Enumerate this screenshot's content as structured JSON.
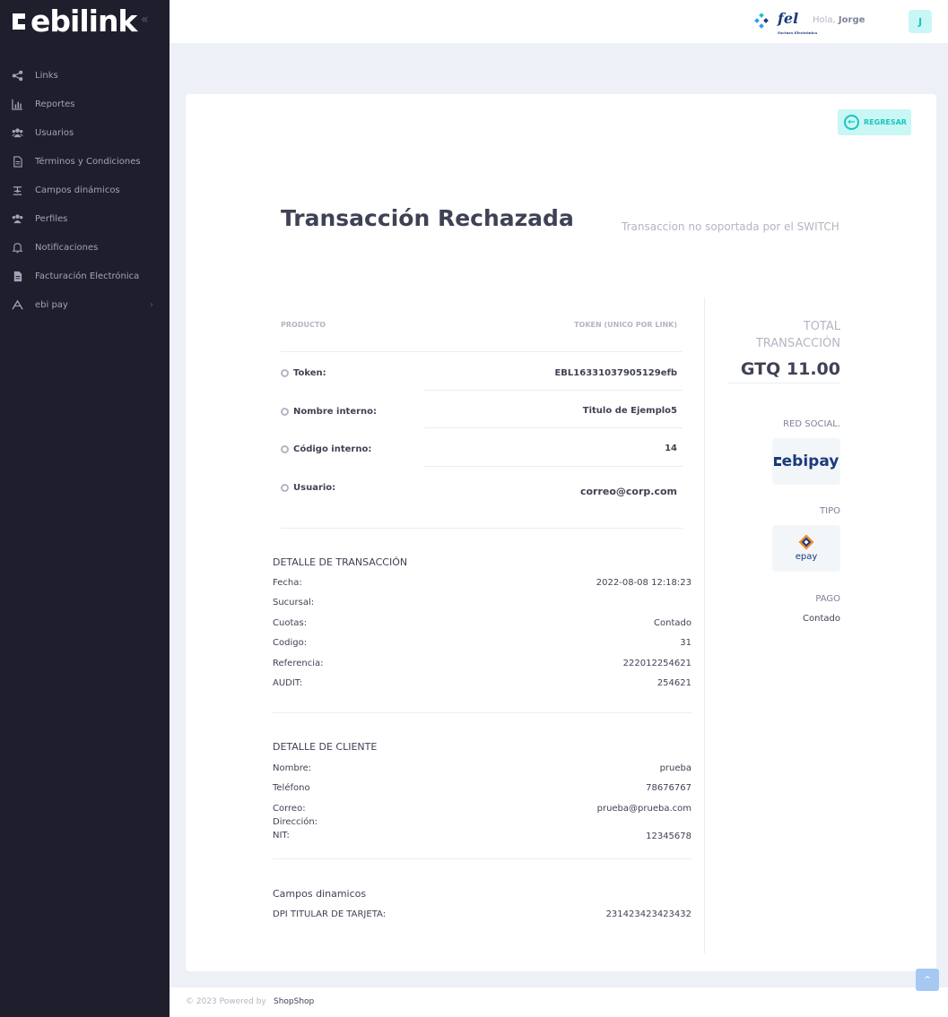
{
  "brand": {
    "logo_text": "ebilink"
  },
  "sidebar": {
    "items": [
      {
        "label": "Links",
        "icon": "share-icon"
      },
      {
        "label": "Reportes",
        "icon": "chart-icon"
      },
      {
        "label": "Usuarios",
        "icon": "users-icon"
      },
      {
        "label": "Términos y Condiciones",
        "icon": "document-icon"
      },
      {
        "label": "Campos dinámicos",
        "icon": "fields-icon"
      },
      {
        "label": "Perfiles",
        "icon": "profiles-icon"
      },
      {
        "label": "Notificaciones",
        "icon": "bell-icon"
      },
      {
        "label": "Facturación Electrónica",
        "icon": "invoice-icon"
      },
      {
        "label": "ebi pay",
        "icon": "ebipay-icon",
        "has_children": true
      }
    ]
  },
  "header": {
    "partner_logo_text": "fel",
    "partner_logo_sub": "Factura Electrónica",
    "greeting": "Hola,",
    "user_name": "Jorge",
    "avatar_initial": "J"
  },
  "card": {
    "back_button": "REGRESAR",
    "title": "Transacción Rechazada",
    "subtitle": "Transaccion no soportada por el SWITCH",
    "product_table": {
      "col_left": "PRODUCTO",
      "col_right": "TOKEN (UNICO POR LINK)",
      "rows": [
        {
          "label": "Token:",
          "value": "EBL16331037905129efb"
        },
        {
          "label": "Nombre interno:",
          "value": "Titulo de Ejemplo5"
        },
        {
          "label": "Código interno:",
          "value": "14"
        },
        {
          "label": "Usuario:",
          "value": "correo@corp.com"
        }
      ]
    },
    "transaction": {
      "title": "DETALLE DE TRANSACCIÓN",
      "rows": [
        {
          "label": "Fecha:",
          "value": "2022-08-08 12:18:23"
        },
        {
          "label": "Sucursal:",
          "value": ""
        },
        {
          "label": "Cuotas:",
          "value": "Contado"
        },
        {
          "label": "Codigo:",
          "value": "31"
        },
        {
          "label": "Referencia:",
          "value": "222012254621"
        },
        {
          "label": "AUDIT:",
          "value": "254621"
        }
      ]
    },
    "client": {
      "title": "DETALLE DE CLIENTE",
      "rows": [
        {
          "label": "Nombre:",
          "value": "prueba"
        },
        {
          "label": "Teléfono",
          "value": "78676767"
        },
        {
          "label": "Correo:",
          "value": "prueba@prueba.com"
        },
        {
          "label": "Dirección:",
          "value": ""
        },
        {
          "label": "NIT:",
          "value": "12345678"
        }
      ]
    },
    "dynamic": {
      "title": "Campos dinamicos",
      "rows": [
        {
          "label": "DPI TITULAR DE TARJETA:",
          "value": "231423423423432"
        }
      ]
    },
    "summary": {
      "total_label_1": "TOTAL",
      "total_label_2": "TRANSACCIÓN",
      "total_value": "GTQ 11.00",
      "red_social_label": "RED SOCIAL.",
      "red_social_logo_text": "ebipay",
      "tipo_label": "TIPO",
      "tipo_logo_text": "epay",
      "pago_label": "PAGO",
      "pago_value": "Contado"
    }
  },
  "footer": {
    "copyright": "© 2023 Powered by",
    "link": "ShopShop"
  },
  "colors": {
    "sidebar_bg": "#1e1e2d",
    "accent": "#1bc5bd",
    "accent_light": "#c9f7f5",
    "page_bg": "#eef0f8"
  }
}
